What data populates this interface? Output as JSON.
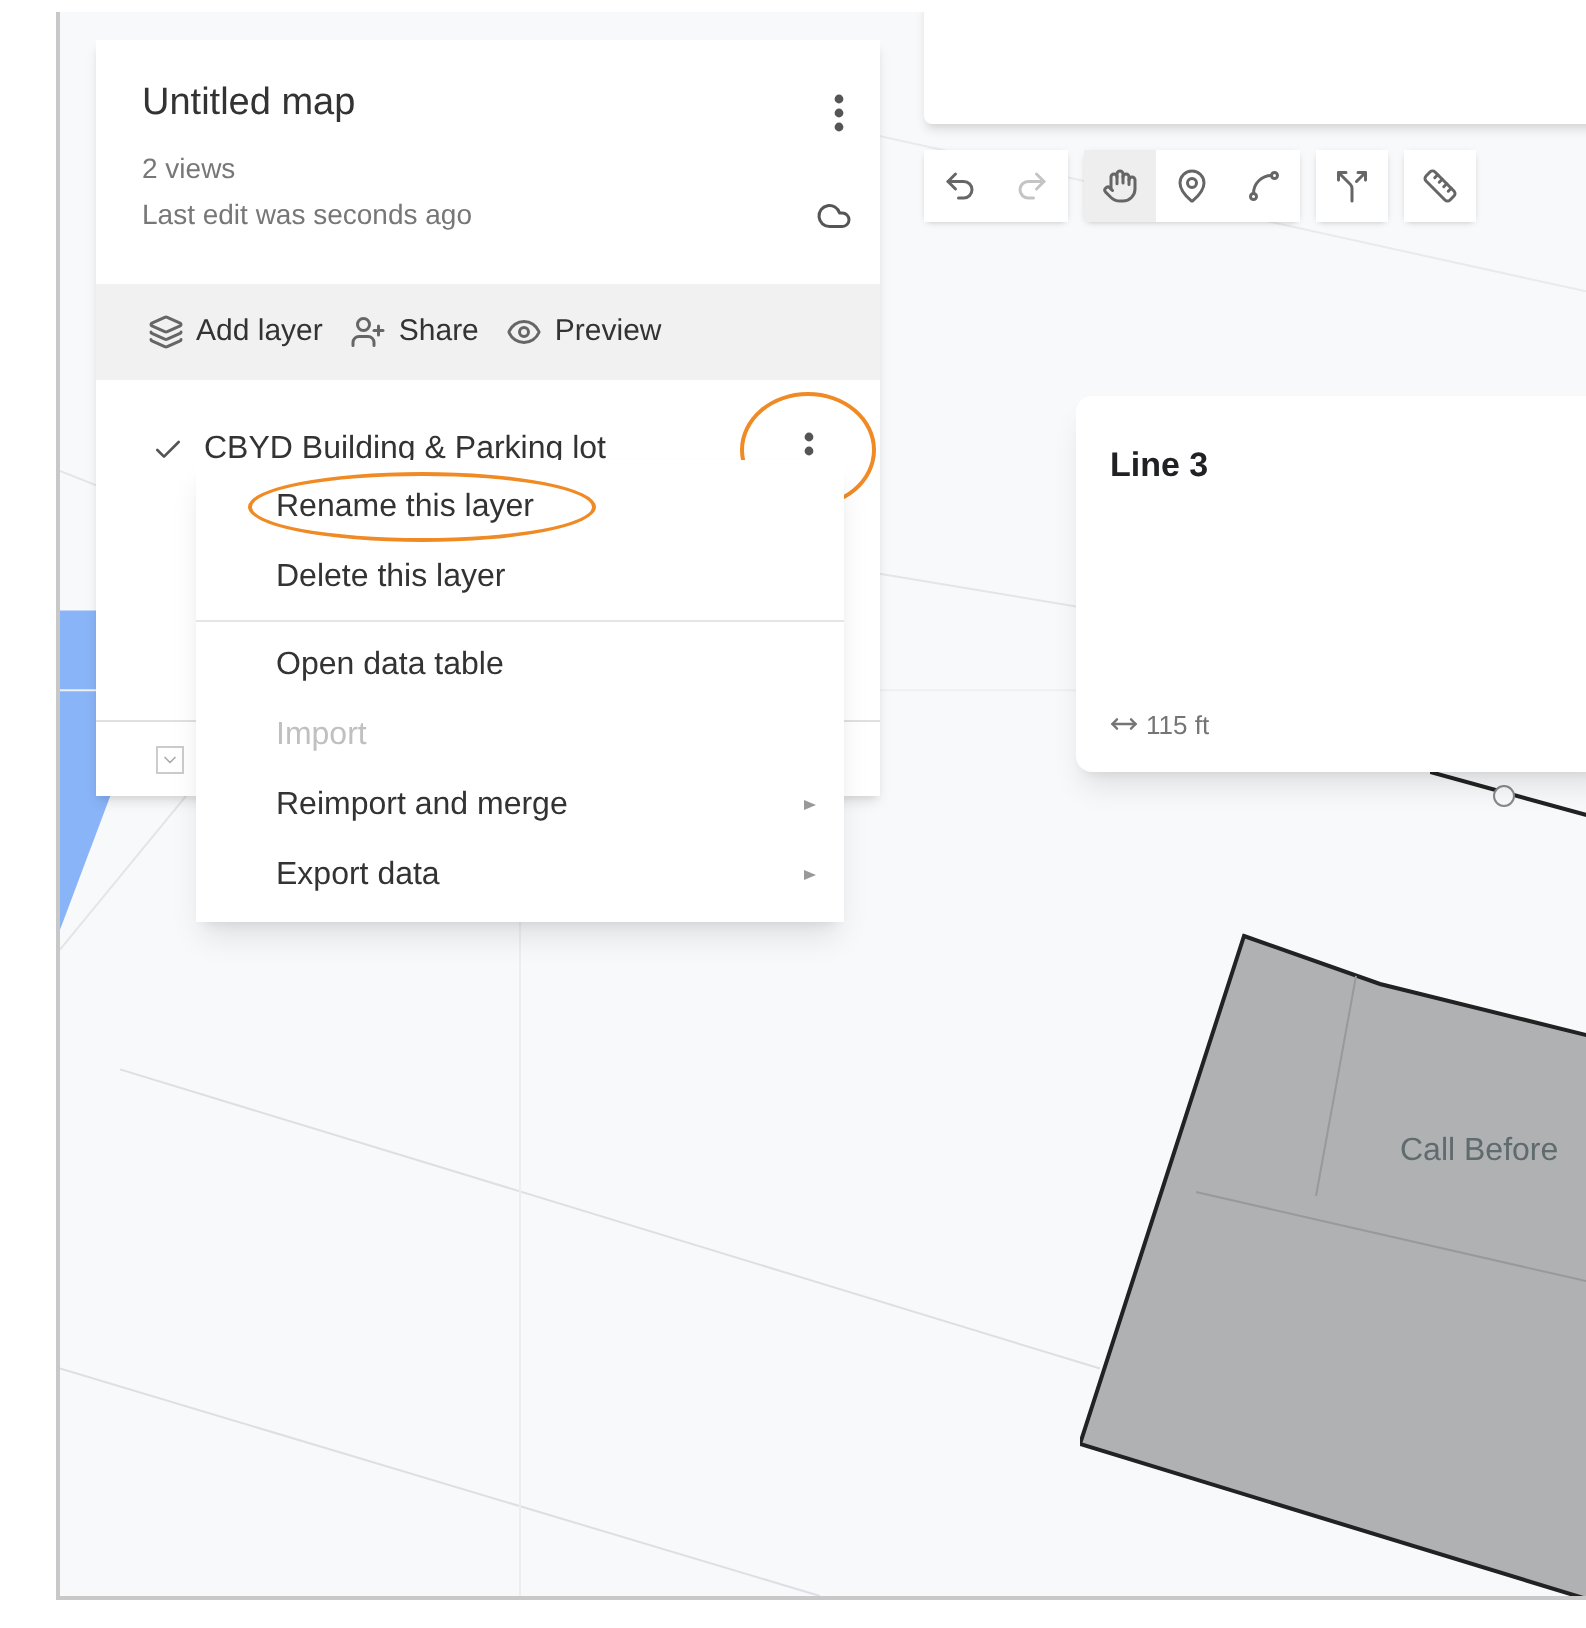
{
  "map_panel": {
    "title": "Untitled map",
    "views": "2 views",
    "last_edit": "Last edit was seconds ago",
    "actions": [
      {
        "label": "Add layer",
        "kind": "layers"
      },
      {
        "label": "Share",
        "kind": "share"
      },
      {
        "label": "Preview",
        "kind": "preview"
      }
    ],
    "layer": {
      "name": "CBYD Building & Parking lot",
      "checked": true,
      "menu_annotated": true
    }
  },
  "layer_menu": {
    "groups": [
      [
        {
          "label": "Rename this layer",
          "disabled": false,
          "submenu": false,
          "annotated": true
        },
        {
          "label": "Delete this layer",
          "disabled": false,
          "submenu": false,
          "annotated": false
        }
      ],
      [
        {
          "label": "Open data table",
          "disabled": false,
          "submenu": false,
          "annotated": false
        },
        {
          "label": "Import",
          "disabled": true,
          "submenu": false,
          "annotated": false
        },
        {
          "label": "Reimport and merge",
          "disabled": false,
          "submenu": true,
          "annotated": false
        },
        {
          "label": "Export data",
          "disabled": false,
          "submenu": true,
          "annotated": false
        }
      ]
    ]
  },
  "toolbar": [
    [
      {
        "kind": "undo",
        "selected": false,
        "disabled": false
      },
      {
        "kind": "redo",
        "selected": false,
        "disabled": true
      }
    ],
    [
      {
        "kind": "hand",
        "selected": true,
        "disabled": false
      },
      {
        "kind": "marker",
        "selected": false,
        "disabled": false
      },
      {
        "kind": "line",
        "selected": false,
        "disabled": false
      }
    ],
    [
      {
        "kind": "route",
        "selected": false,
        "disabled": false
      }
    ],
    [
      {
        "kind": "ruler",
        "selected": false,
        "disabled": false
      }
    ]
  ],
  "popup": {
    "title": "Line 3",
    "measure": "115 ft"
  },
  "feature_label": "Call Before"
}
